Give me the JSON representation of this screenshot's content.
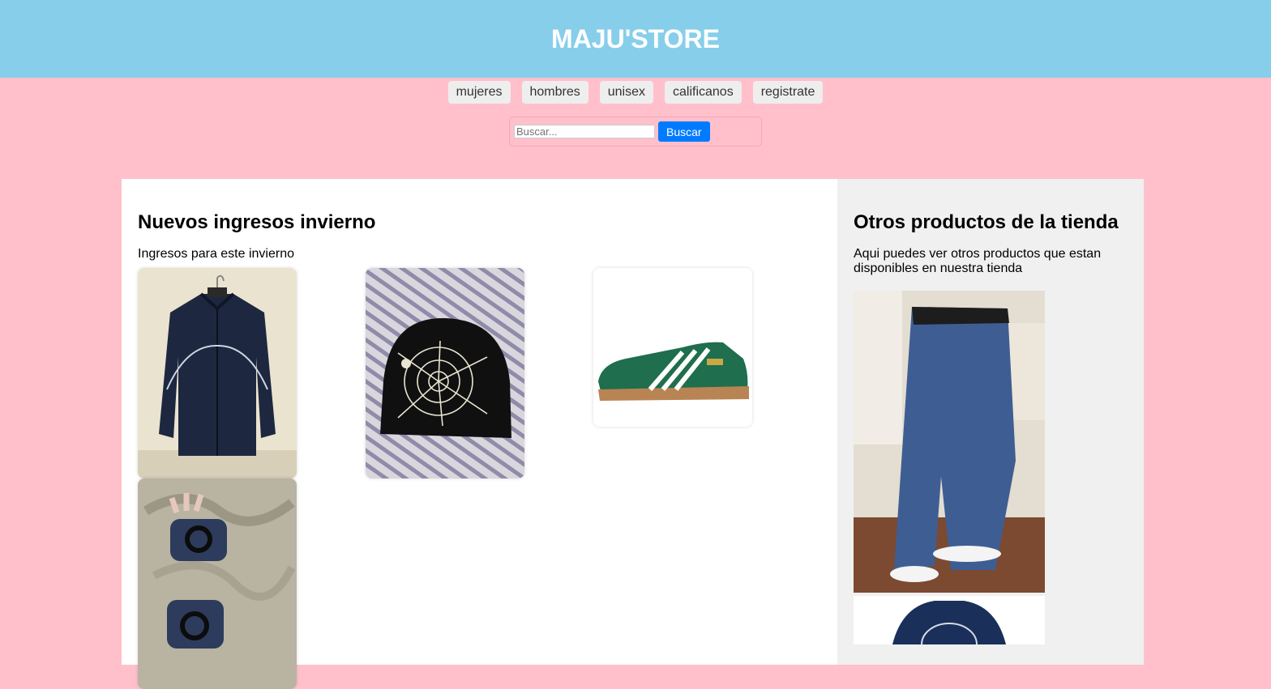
{
  "header": {
    "title": "MAJU'STORE"
  },
  "nav": {
    "items": [
      "mujeres",
      "hombres",
      "unisex",
      "calificanos",
      "registrate"
    ]
  },
  "search": {
    "placeholder": "Buscar...",
    "button": "Buscar"
  },
  "main": {
    "title": "Nuevos ingresos invierno",
    "subtitle": "Ingresos para este invierno",
    "products": [
      "jacket",
      "beanie",
      "sneaker",
      "gloves"
    ]
  },
  "aside": {
    "title": "Otros productos de la tienda",
    "text": "Aqui puedes ver otros productos que estan disponibles en nuestra tienda",
    "products": [
      "jeans",
      "sweater"
    ]
  },
  "colors": {
    "header": "#87ceeb",
    "page": "#ffc0cb",
    "button": "#007bff",
    "aside": "#f0f0f0"
  }
}
